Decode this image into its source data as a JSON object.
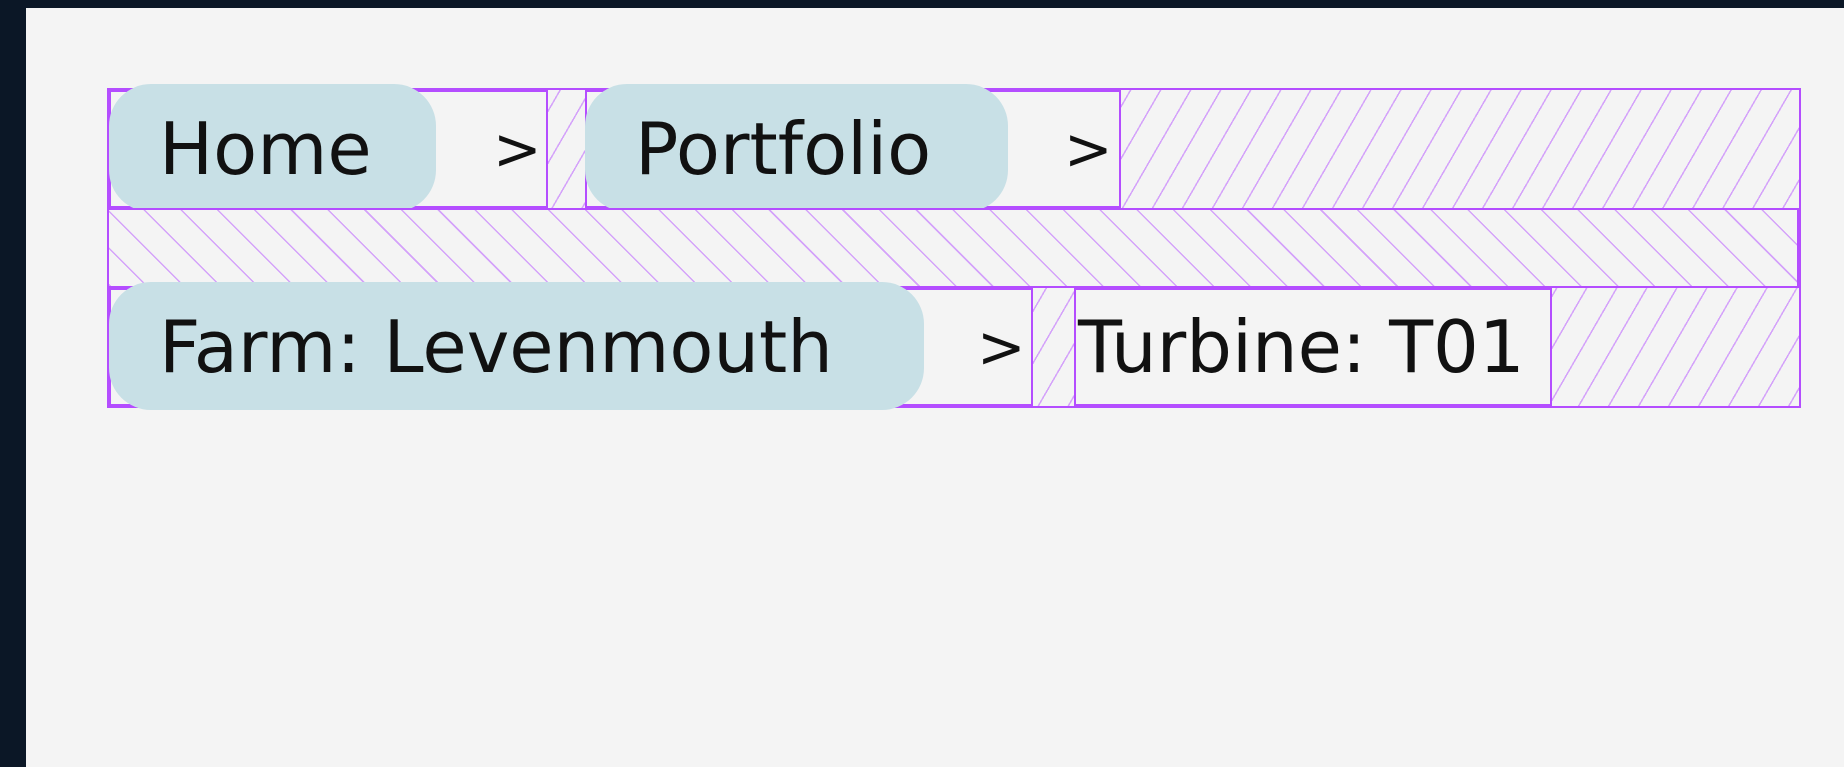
{
  "breadcrumb": {
    "separator": ">",
    "items": [
      {
        "label": "Home"
      },
      {
        "label": "Portfolio"
      },
      {
        "label": "Farm: Levenmouth"
      }
    ],
    "current": {
      "label": "Turbine: T01"
    }
  },
  "colors": {
    "pill": "#c8e0e6",
    "outline": "#b44dff",
    "background": "#f4f4f4",
    "frame": "#0b1726"
  }
}
